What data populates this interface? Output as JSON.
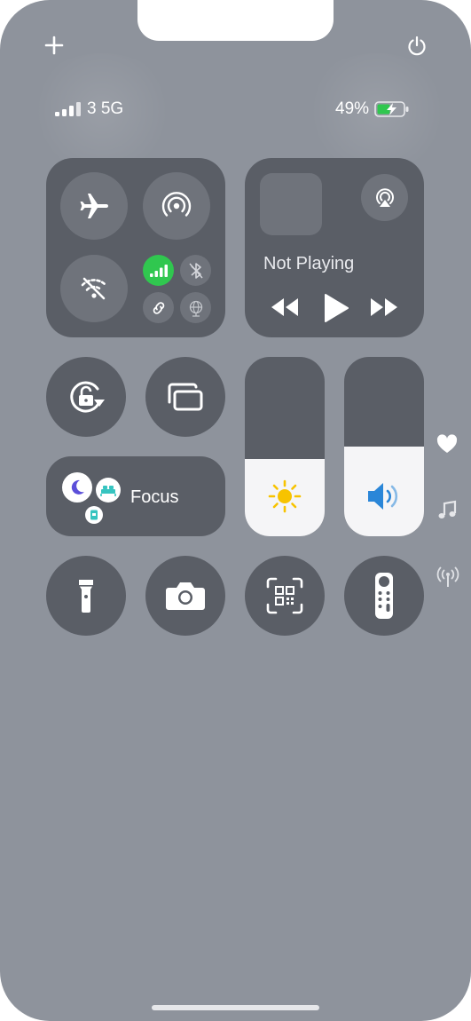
{
  "status_bar": {
    "carrier": "3 5G",
    "battery_percent": "49%"
  },
  "connectivity": {
    "airplane_mode": "off",
    "airdrop": "on",
    "wifi": "off",
    "cellular": "on",
    "bluetooth": "off",
    "hotspot": "off",
    "vpn": "off"
  },
  "now_playing": {
    "status": "Not Playing"
  },
  "focus": {
    "label": "Focus"
  },
  "levels": {
    "brightness": 0.43,
    "volume": 0.5
  },
  "colors": {
    "background": "#8e939c",
    "tile": "#5a5e66",
    "cellular_green": "#30c74f",
    "focus_moon": "#5b4fd9",
    "focus_sleep": "#36c4c0",
    "brightness_sun": "#f7c300",
    "volume_speaker": "#2a86d8"
  },
  "icons": {
    "add": "plus-icon",
    "power": "power-icon",
    "airplane": "airplane-icon",
    "airdrop": "airdrop-icon",
    "wifi": "wifi-off-icon",
    "cellular": "cellular-icon",
    "bluetooth": "bluetooth-icon",
    "hotspot": "hotspot-icon",
    "vpn": "globe-icon",
    "airplay": "airplay-icon",
    "rotation_lock": "rotation-lock-icon",
    "screen_mirroring": "screen-mirroring-icon",
    "flashlight": "flashlight-icon",
    "camera": "camera-icon",
    "qr_scanner": "qr-code-icon",
    "remote": "apple-tv-remote-icon",
    "heart": "heart-icon",
    "music": "music-note-icon",
    "antenna": "antenna-icon"
  }
}
